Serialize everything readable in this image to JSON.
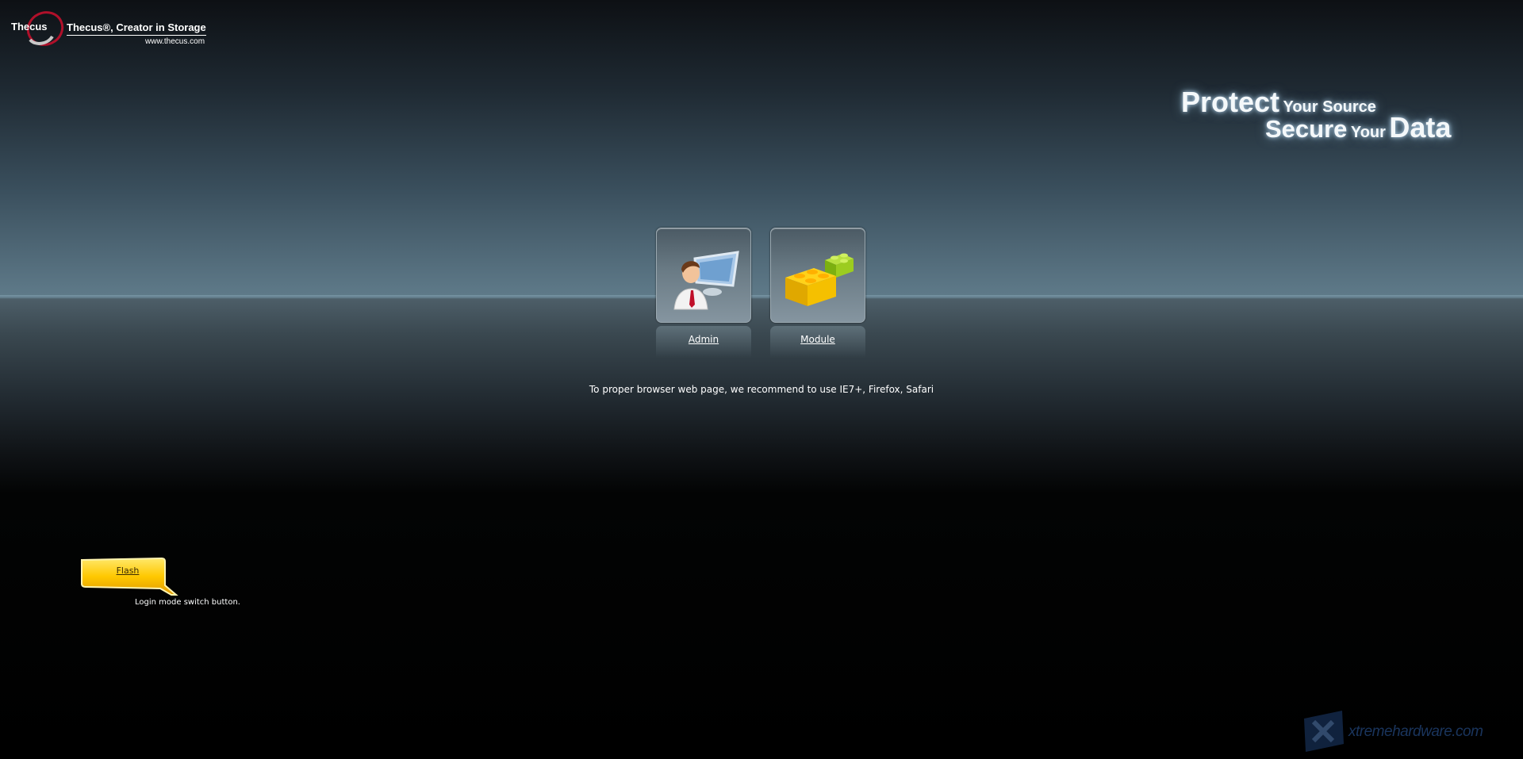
{
  "brand": {
    "name": "Thecus",
    "tagline": "Thecus®, Creator in Storage",
    "url": "www.thecus.com"
  },
  "slogan": {
    "word1": "Protect",
    "word2": "Your Source",
    "word3": "Secure",
    "word4": "Your",
    "word5": "Data"
  },
  "tiles": [
    {
      "label": "Admin",
      "icon": "admin-user-monitor-icon"
    },
    {
      "label": "Module",
      "icon": "module-blocks-icon"
    }
  ],
  "recommendation": "To proper browser web page, we recommend to use IE7+, Firefox, Safari",
  "flash_switch": {
    "label": "Flash",
    "help": "Login mode switch button.",
    "color": "#f5c400"
  },
  "watermark": {
    "text": "xtremehardware.com"
  }
}
